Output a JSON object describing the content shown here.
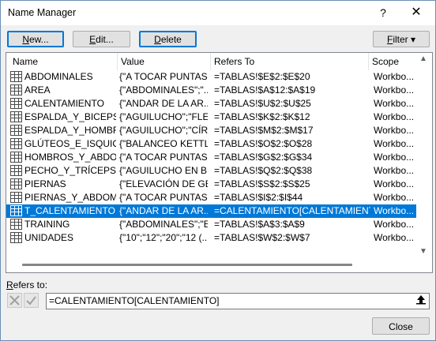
{
  "window": {
    "title": "Name Manager",
    "help": "?",
    "close": "✕"
  },
  "toolbar": {
    "new_label_key": "N",
    "new_label_rest": "ew...",
    "edit_label_key": "E",
    "edit_label_rest": "dit...",
    "delete_label_key": "D",
    "delete_label_rest": "elete",
    "filter_label_key": "F",
    "filter_label_rest": "ilter ▾"
  },
  "table": {
    "columns": {
      "name": "Name",
      "value": "Value",
      "refers": "Refers To",
      "scope": "Scope"
    },
    "rows": [
      {
        "name": "ABDOMINALES",
        "value": "{\"A TOCAR PUNTAS ...",
        "refers": "=TABLAS!$E$2:$E$20",
        "scope": "Workbo..."
      },
      {
        "name": "AREA",
        "value": "{\"ABDOMINALES\";\"...",
        "refers": "=TABLAS!$A$12:$A$19",
        "scope": "Workbo..."
      },
      {
        "name": "CALENTAMIENTO",
        "value": "{\"ANDAR DE LA AR...",
        "refers": "=TABLAS!$U$2:$U$25",
        "scope": "Workbo..."
      },
      {
        "name": "ESPALDA_Y_BICEPS",
        "value": "{\"AGUILUCHO\";\"FLE...",
        "refers": "=TABLAS!$K$2:$K$12",
        "scope": "Workbo..."
      },
      {
        "name": "ESPALDA_Y_HOMBRO...",
        "value": "{\"AGUILUCHO\";\"CÍR...",
        "refers": "=TABLAS!$M$2:$M$17",
        "scope": "Workbo..."
      },
      {
        "name": "GLÚTEOS_E_ISQUIO...",
        "value": "{\"BALANCEO KETTL...",
        "refers": "=TABLAS!$O$2:$O$28",
        "scope": "Workbo..."
      },
      {
        "name": "HOMBROS_Y_ABDO...",
        "value": "{\"A TOCAR PUNTAS ...",
        "refers": "=TABLAS!$G$2:$G$34",
        "scope": "Workbo..."
      },
      {
        "name": "PECHO_Y_TRÍCEPS",
        "value": "{\"AGUILUCHO EN B...",
        "refers": "=TABLAS!$Q$2:$Q$38",
        "scope": "Workbo..."
      },
      {
        "name": "PIERNAS",
        "value": "{\"ELEVACIÓN DE GE...",
        "refers": "=TABLAS!$S$2:$S$25",
        "scope": "Workbo..."
      },
      {
        "name": "PIERNAS_Y_ABDOMI...",
        "value": "{\"A TOCAR PUNTAS ...",
        "refers": "=TABLAS!$I$2:$I$44",
        "scope": "Workbo..."
      },
      {
        "name": "T_CALENTAMIENTO",
        "value": "{\"ANDAR DE LA AR...",
        "refers": "=CALENTAMIENTO[CALENTAMIENTO]",
        "scope": "Workbo..."
      },
      {
        "name": "TRAINING",
        "value": "{\"ABDOMINALES\";\"E...",
        "refers": "=TABLAS!$A$3:$A$9",
        "scope": "Workbo..."
      },
      {
        "name": "UNIDADES",
        "value": "{\"10\";\"12\";\"20\";\"12 (...",
        "refers": "=TABLAS!$W$2:$W$7",
        "scope": "Workbo..."
      }
    ],
    "selected_index": 10
  },
  "refers_section": {
    "label_key": "R",
    "label_rest": "efers to:",
    "value": "=CALENTAMIENTO[CALENTAMIENTO]"
  },
  "footer": {
    "close_label": "Close"
  },
  "colors": {
    "selection": "#0078d7",
    "default_button_border": "#0078d7"
  }
}
